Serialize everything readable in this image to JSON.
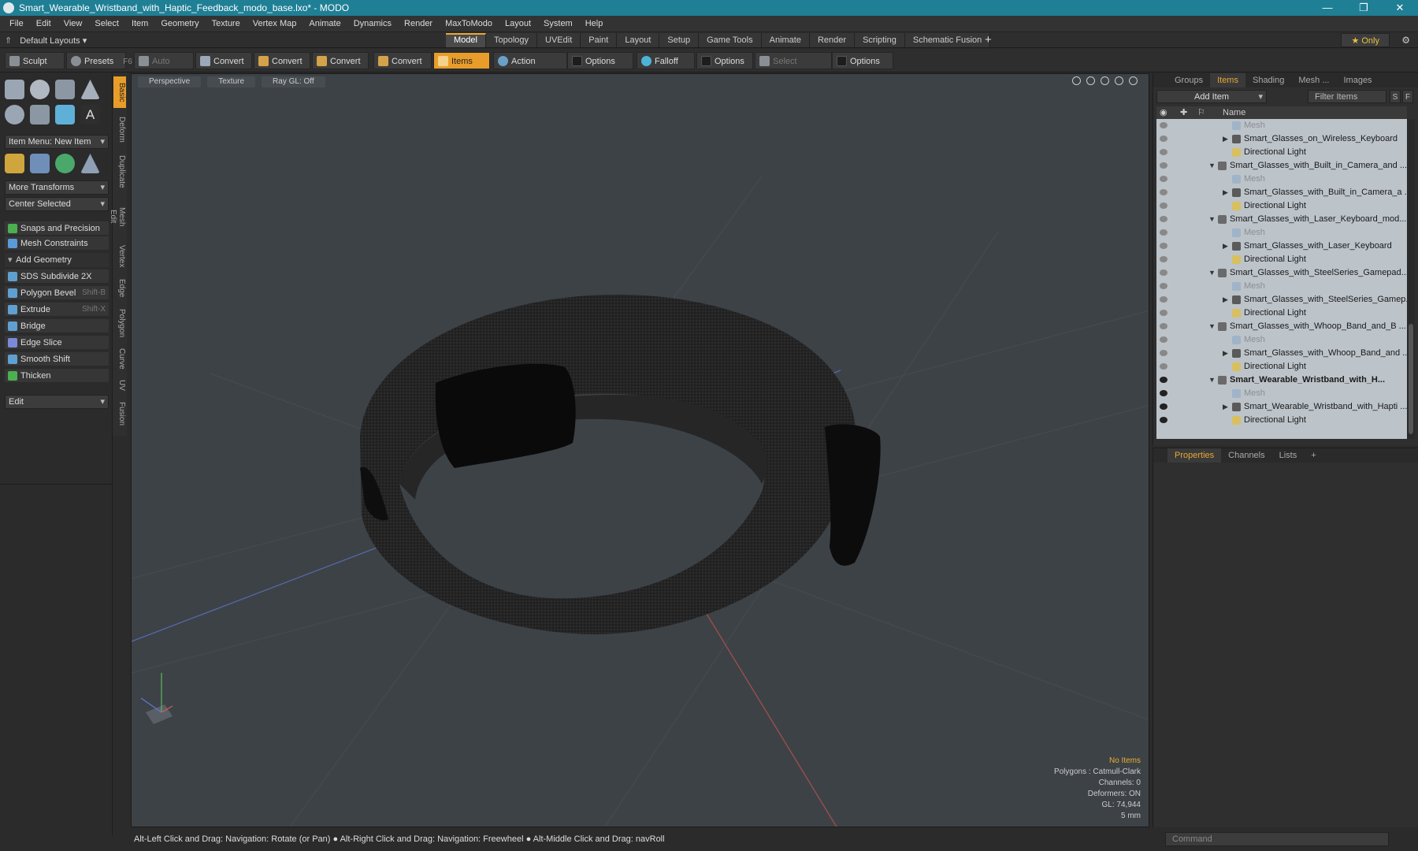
{
  "window": {
    "title": "Smart_Wearable_Wristband_with_Haptic_Feedback_modo_base.lxo* - MODO",
    "controls": [
      "—",
      "❐",
      "✕"
    ]
  },
  "menu": [
    "File",
    "Edit",
    "View",
    "Select",
    "Item",
    "Geometry",
    "Texture",
    "Vertex Map",
    "Animate",
    "Dynamics",
    "Render",
    "MaxToModo",
    "Layout",
    "System",
    "Help"
  ],
  "layouts": {
    "default_label": "Default Layouts",
    "tabs": [
      "Model",
      "Topology",
      "UVEdit",
      "Paint",
      "Layout",
      "Setup",
      "Game Tools",
      "Animate",
      "Render",
      "Scripting",
      "Schematic Fusion"
    ],
    "active_tab": "Model",
    "only_label": "Only",
    "plus": "+"
  },
  "toolbar": {
    "sculpt": "Sculpt",
    "presets": "Presets",
    "presets_key": "F6",
    "auto_select": "Auto Select",
    "convert1": "Convert",
    "convert2": "Convert",
    "convert3": "Convert",
    "convert4": "Convert",
    "items": "Items",
    "action_center": "Action Center",
    "options1": "Options",
    "falloff": "Falloff",
    "options2": "Options",
    "select_through": "Select Through",
    "options3": "Options"
  },
  "left_panel": {
    "item_menu": "Item Menu: New Item",
    "more_transforms": "More Transforms",
    "center_selected": "Center Selected",
    "snaps": "Snaps and Precision",
    "mesh_constraints": "Mesh Constraints",
    "add_geometry": "Add Geometry",
    "tools": [
      {
        "label": "SDS Subdivide 2X",
        "shortcut": ""
      },
      {
        "label": "Polygon Bevel",
        "shortcut": "Shift-B"
      },
      {
        "label": "Extrude",
        "shortcut": "Shift-X"
      },
      {
        "label": "Bridge",
        "shortcut": ""
      },
      {
        "label": "Edge Slice",
        "shortcut": ""
      },
      {
        "label": "Smooth Shift",
        "shortcut": ""
      },
      {
        "label": "Thicken",
        "shortcut": ""
      }
    ],
    "edit": "Edit"
  },
  "vertical_tabs": [
    "Basic",
    "Deform",
    "Duplicate",
    "Mesh Edit",
    "Vertex",
    "Edge",
    "Polygon",
    "Curve",
    "UV",
    "Fusion"
  ],
  "viewport": {
    "view_mode": "Perspective",
    "shading": "Texture",
    "raygl": "Ray GL: Off",
    "info": {
      "no_items": "No Items",
      "polygons": "Polygons : Catmull-Clark",
      "channels": "Channels: 0",
      "deformers": "Deformers: ON",
      "gl": "GL: 74,944",
      "scale": "5 mm"
    }
  },
  "status_bar": "Alt-Left Click and Drag: Navigation: Rotate (or Pan) ● Alt-Right Click and Drag: Navigation: Freewheel ● Alt-Middle Click and Drag: navRoll",
  "items_panel": {
    "tabs": [
      "Groups",
      "Items",
      "Shading",
      "Mesh ...",
      "Images"
    ],
    "active_tab": "Items",
    "add_item": "Add Item",
    "filter": "Filter Items",
    "s_btn": "S",
    "f_btn": "F",
    "name_header": "Name",
    "rows": [
      {
        "label": "Mesh",
        "kind": "mesh",
        "depth": 2,
        "visible": false
      },
      {
        "label": "Smart_Glasses_on_Wireless_Keyboard",
        "kind": "child",
        "depth": 2,
        "visible": false
      },
      {
        "label": "Directional Light",
        "kind": "light",
        "depth": 2,
        "visible": false
      },
      {
        "label": "Smart_Glasses_with_Built_in_Camera_and ...",
        "kind": "group",
        "depth": 1,
        "visible": false
      },
      {
        "label": "Mesh",
        "kind": "mesh",
        "depth": 2,
        "visible": false
      },
      {
        "label": "Smart_Glasses_with_Built_in_Camera_a ...",
        "kind": "child",
        "depth": 2,
        "visible": false
      },
      {
        "label": "Directional Light",
        "kind": "light",
        "depth": 2,
        "visible": false
      },
      {
        "label": "Smart_Glasses_with_Laser_Keyboard_mod...",
        "kind": "group",
        "depth": 1,
        "visible": false
      },
      {
        "label": "Mesh",
        "kind": "mesh",
        "depth": 2,
        "visible": false
      },
      {
        "label": "Smart_Glasses_with_Laser_Keyboard",
        "kind": "child",
        "depth": 2,
        "visible": false
      },
      {
        "label": "Directional Light",
        "kind": "light",
        "depth": 2,
        "visible": false
      },
      {
        "label": "Smart_Glasses_with_SteelSeries_Gamepad...",
        "kind": "group",
        "depth": 1,
        "visible": false
      },
      {
        "label": "Mesh",
        "kind": "mesh",
        "depth": 2,
        "visible": false
      },
      {
        "label": "Smart_Glasses_with_SteelSeries_Gamep...",
        "kind": "child",
        "depth": 2,
        "visible": false
      },
      {
        "label": "Directional Light",
        "kind": "light",
        "depth": 2,
        "visible": false
      },
      {
        "label": "Smart_Glasses_with_Whoop_Band_and_B ...",
        "kind": "group",
        "depth": 1,
        "visible": false
      },
      {
        "label": "Mesh",
        "kind": "mesh",
        "depth": 2,
        "visible": false
      },
      {
        "label": "Smart_Glasses_with_Whoop_Band_and ...",
        "kind": "child",
        "depth": 2,
        "visible": false
      },
      {
        "label": "Directional Light",
        "kind": "light",
        "depth": 2,
        "visible": false
      },
      {
        "label": "Smart_Wearable_Wristband_with_H...",
        "kind": "group",
        "depth": 1,
        "visible": true,
        "bold": true
      },
      {
        "label": "Mesh",
        "kind": "mesh",
        "depth": 2,
        "visible": true
      },
      {
        "label": "Smart_Wearable_Wristband_with_Hapti ...",
        "kind": "child",
        "depth": 2,
        "visible": true
      },
      {
        "label": "Directional Light",
        "kind": "light",
        "depth": 2,
        "visible": true
      }
    ]
  },
  "properties_panel": {
    "tabs": [
      "Properties",
      "Channels",
      "Lists"
    ],
    "active_tab": "Properties",
    "plus": "+"
  },
  "command": {
    "placeholder": "Command"
  },
  "colors": {
    "titlebar": "#1f7f95",
    "accent": "#e89d2a",
    "viewport_bg": "#3d4247",
    "item_list_bg": "#bcc3c9"
  }
}
